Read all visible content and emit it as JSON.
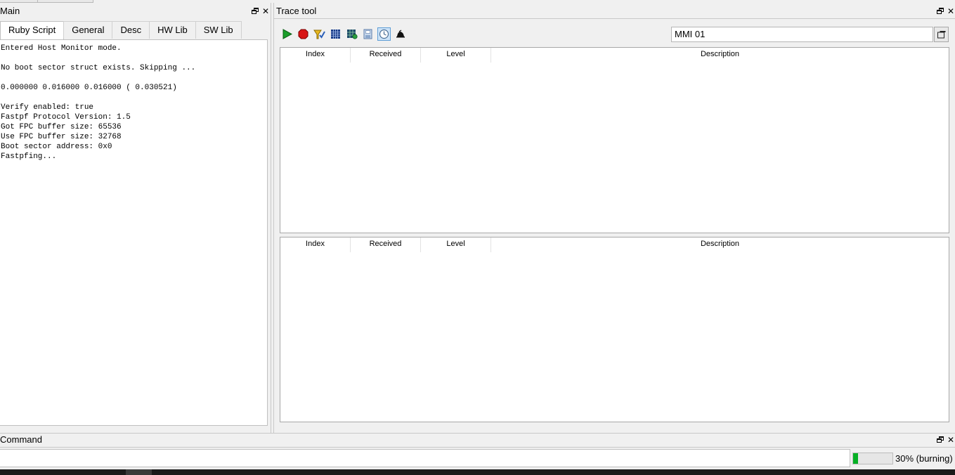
{
  "main_panel": {
    "title": "Main",
    "tabs": [
      {
        "label": "Ruby Script",
        "active": true
      },
      {
        "label": "General",
        "active": false
      },
      {
        "label": "Desc",
        "active": false
      },
      {
        "label": "HW Lib",
        "active": false
      },
      {
        "label": "SW Lib",
        "active": false
      }
    ],
    "script_output": [
      "Entered Host Monitor mode.",
      "",
      "No boot sector struct exists. Skipping ...",
      "",
      "0.000000 0.016000 0.016000 ( 0.030521)",
      "",
      "Verify enabled: true",
      "Fastpf Protocol Version: 1.5",
      "Got FPC buffer size: 65536",
      "Use FPC buffer size: 32768",
      "Boot sector address: 0x0",
      "Fastpfing..."
    ]
  },
  "trace_panel": {
    "title": "Trace tool",
    "toolbar": [
      {
        "icon": "play-icon"
      },
      {
        "icon": "stop-icon"
      },
      {
        "icon": "filter-icon"
      },
      {
        "icon": "grid-icon"
      },
      {
        "icon": "grid-settings-icon"
      },
      {
        "icon": "save-icon"
      },
      {
        "icon": "clock-icon",
        "active": true
      },
      {
        "icon": "bell-icon"
      }
    ],
    "mmi_field": "MMI 01",
    "table_top": {
      "columns": [
        "Index",
        "Received",
        "Level",
        "Description"
      ]
    },
    "table_bottom": {
      "columns": [
        "Index",
        "Received",
        "Level",
        "Description"
      ]
    }
  },
  "command_panel": {
    "title": "Command",
    "input_value": "",
    "progress": {
      "fraction": 0.3,
      "label": "30% (burning)"
    }
  },
  "colors": {
    "progress_fill": "#06b025",
    "active_tool_bg": "#cde3f7",
    "panel_bg": "#f0f0f0"
  }
}
